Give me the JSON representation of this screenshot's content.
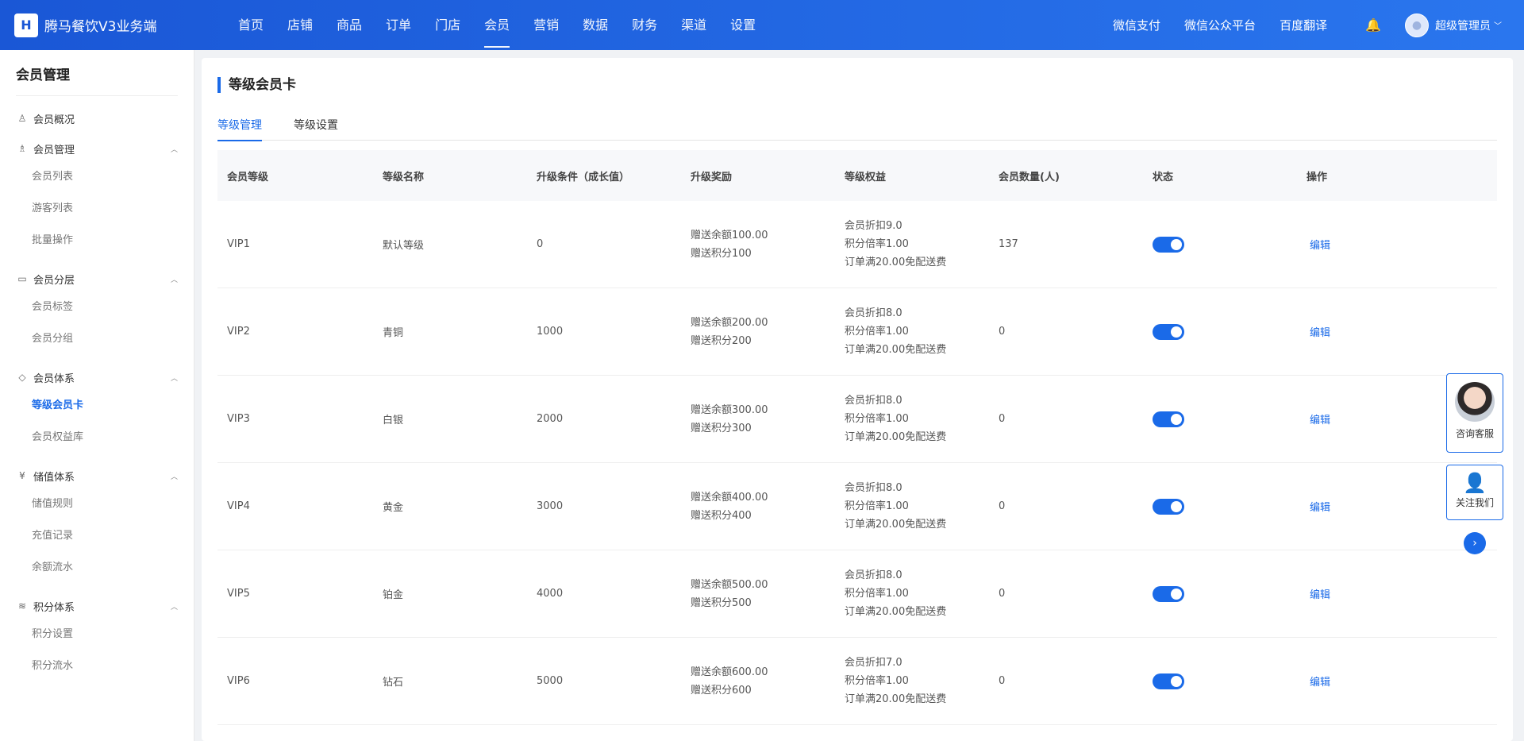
{
  "header": {
    "brand": "腾马餐饮V3业务端",
    "logo_text": "H",
    "nav": [
      "首页",
      "店铺",
      "商品",
      "订单",
      "门店",
      "会员",
      "营销",
      "数据",
      "财务",
      "渠道",
      "设置"
    ],
    "active_nav": "会员",
    "right_links": [
      "微信支付",
      "微信公众平台",
      "百度翻译"
    ],
    "user_name": "超级管理员"
  },
  "sidebar": {
    "title": "会员管理",
    "overview": "会员概况",
    "sections": [
      {
        "label": "会员管理",
        "icon": "users-icon",
        "items": [
          "会员列表",
          "游客列表",
          "批量操作"
        ]
      },
      {
        "label": "会员分层",
        "icon": "card-icon",
        "items": [
          "会员标签",
          "会员分组"
        ]
      },
      {
        "label": "会员体系",
        "icon": "tag-icon",
        "items": [
          "等级会员卡",
          "会员权益库"
        ]
      },
      {
        "label": "储值体系",
        "icon": "coin-icon",
        "items": [
          "储值规则",
          "充值记录",
          "余额流水"
        ]
      },
      {
        "label": "积分体系",
        "icon": "stack-icon",
        "items": [
          "积分设置",
          "积分流水"
        ]
      }
    ],
    "active_item": "等级会员卡"
  },
  "main": {
    "title": "等级会员卡",
    "tabs": [
      "等级管理",
      "等级设置"
    ],
    "active_tab": "等级管理",
    "columns": [
      "会员等级",
      "等级名称",
      "升级条件（成长值）",
      "升级奖励",
      "等级权益",
      "会员数量(人)",
      "状态",
      "操作"
    ],
    "rows": [
      {
        "level": "VIP1",
        "name": "默认等级",
        "cond": "0",
        "reward": [
          "赠送余额100.00",
          "赠送积分100"
        ],
        "rights": [
          "会员折扣9.0",
          "积分倍率1.00",
          "订单满20.00免配送费"
        ],
        "count": "137",
        "enabled": true,
        "action": "编辑"
      },
      {
        "level": "VIP2",
        "name": "青铜",
        "cond": "1000",
        "reward": [
          "赠送余额200.00",
          "赠送积分200"
        ],
        "rights": [
          "会员折扣8.0",
          "积分倍率1.00",
          "订单满20.00免配送费"
        ],
        "count": "0",
        "enabled": true,
        "action": "编辑"
      },
      {
        "level": "VIP3",
        "name": "白银",
        "cond": "2000",
        "reward": [
          "赠送余额300.00",
          "赠送积分300"
        ],
        "rights": [
          "会员折扣8.0",
          "积分倍率1.00",
          "订单满20.00免配送费"
        ],
        "count": "0",
        "enabled": true,
        "action": "编辑"
      },
      {
        "level": "VIP4",
        "name": "黄金",
        "cond": "3000",
        "reward": [
          "赠送余额400.00",
          "赠送积分400"
        ],
        "rights": [
          "会员折扣8.0",
          "积分倍率1.00",
          "订单满20.00免配送费"
        ],
        "count": "0",
        "enabled": true,
        "action": "编辑"
      },
      {
        "level": "VIP5",
        "name": "铂金",
        "cond": "4000",
        "reward": [
          "赠送余额500.00",
          "赠送积分500"
        ],
        "rights": [
          "会员折扣8.0",
          "积分倍率1.00",
          "订单满20.00免配送费"
        ],
        "count": "0",
        "enabled": true,
        "action": "编辑"
      },
      {
        "level": "VIP6",
        "name": "钻石",
        "cond": "5000",
        "reward": [
          "赠送余额600.00",
          "赠送积分600"
        ],
        "rights": [
          "会员折扣7.0",
          "积分倍率1.00",
          "订单满20.00免配送费"
        ],
        "count": "0",
        "enabled": true,
        "action": "编辑"
      }
    ]
  },
  "float": {
    "cs_label": "咨询客服",
    "follow_label": "关注我们"
  },
  "colors": {
    "accent": "#1a6ae8",
    "header_start": "#1a57d6",
    "header_end": "#2a76ee"
  }
}
